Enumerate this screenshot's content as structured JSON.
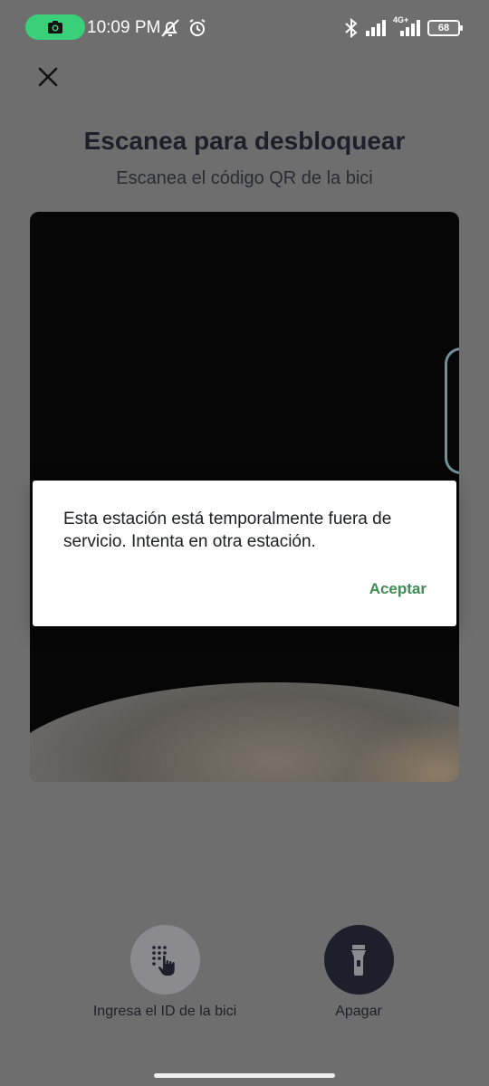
{
  "status_bar": {
    "time": "10:09 PM",
    "network": "4G+",
    "battery": "68",
    "icons": [
      "screen-record-icon",
      "mute-icon",
      "alarm-icon",
      "bluetooth-icon",
      "signal-icon",
      "signal-4g-icon",
      "battery-icon"
    ]
  },
  "header": {
    "close_icon": "close-icon",
    "title": "Escanea para desbloquear",
    "subtitle": "Escanea el código QR de la bici"
  },
  "dialog": {
    "message": "Esta estación está temporalmente fuera de servicio. Intenta en otra estación.",
    "button": "Aceptar"
  },
  "actions": [
    {
      "label": "Ingresa el ID de la bici",
      "icon": "keypad-touch-icon"
    },
    {
      "label": "Apagar",
      "icon": "flashlight-icon"
    }
  ],
  "colors": {
    "accent_green": "#3f8c56",
    "dark_button": "#1e1f2a",
    "overlay": "#6e6e6e",
    "record_pill": "#3ad07a"
  }
}
